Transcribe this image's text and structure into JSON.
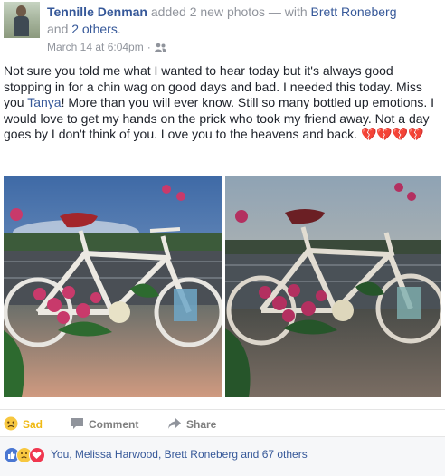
{
  "post": {
    "author": "Tennille Denman",
    "action_text": "added 2 new photos — with",
    "tagged_person": "Brett Roneberg",
    "and_text": "and",
    "others": "2 others",
    "period": ".",
    "timestamp": "March 14 at 6:04pm",
    "meta_sep": "·",
    "audience_icon": "friends-icon",
    "text_part1": "Not sure you told me what I wanted to hear today but it's always good stopping in for a chin wag on good days and bad. I needed this today. Miss you ",
    "mention": "Tanya",
    "text_part2": "! More than you will ever know. Still so many bottled up emotions. I would love to get my hands on the prick who took my friend away. Not a day goes by I don't think of you. Love you to the heavens and back. 💔💔💔💔"
  },
  "actions": {
    "sad_label": "Sad",
    "comment_label": "Comment",
    "share_label": "Share",
    "sad_color": "#f0ba15"
  },
  "reactions": {
    "summary": "You, Melissa Harwood, Brett Roneberg and 67 others",
    "icons": [
      "like-icon",
      "sad-icon",
      "love-icon"
    ]
  },
  "colors": {
    "link": "#365899",
    "muted": "#90949c",
    "text": "#1d2129"
  }
}
